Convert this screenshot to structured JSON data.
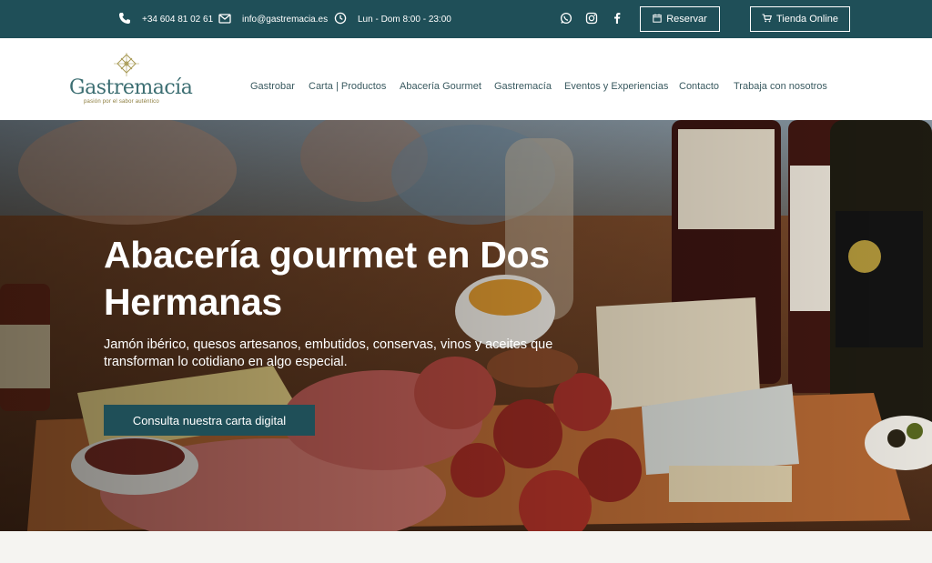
{
  "topbar": {
    "phone": "+34 604 81 02 61",
    "email": "info@gastremacia.es",
    "hours": "Lun - Dom 8:00 - 23:00",
    "reserve_label": "Reservar",
    "shop_label": "Tienda Online",
    "icons": [
      "phone-icon",
      "mail-icon",
      "clock-icon",
      "whatsapp-icon",
      "instagram-icon",
      "facebook-icon",
      "calendar-icon",
      "cart-icon"
    ]
  },
  "brand": {
    "name": "Gastremacía",
    "tagline": "pasión por el sabor auténtico",
    "colors": {
      "primary": "#1f4f58",
      "logo": "#3c6e72",
      "gold": "#8a7a3a"
    }
  },
  "nav": {
    "items": [
      "Gastrobar",
      "Carta | Productos",
      "Abacería Gourmet",
      "Gastremacía",
      "Eventos y Experiencias",
      "Contacto",
      "Trabaja con nosotros"
    ]
  },
  "hero": {
    "title": "Abacería gourmet en Dos Hermanas",
    "subtitle": "Jamón ibérico, quesos artesanos, embutidos, conservas, vinos y aceites que transforman lo cotidiano en algo especial.",
    "cta_label": "Consulta nuestra carta digital"
  }
}
